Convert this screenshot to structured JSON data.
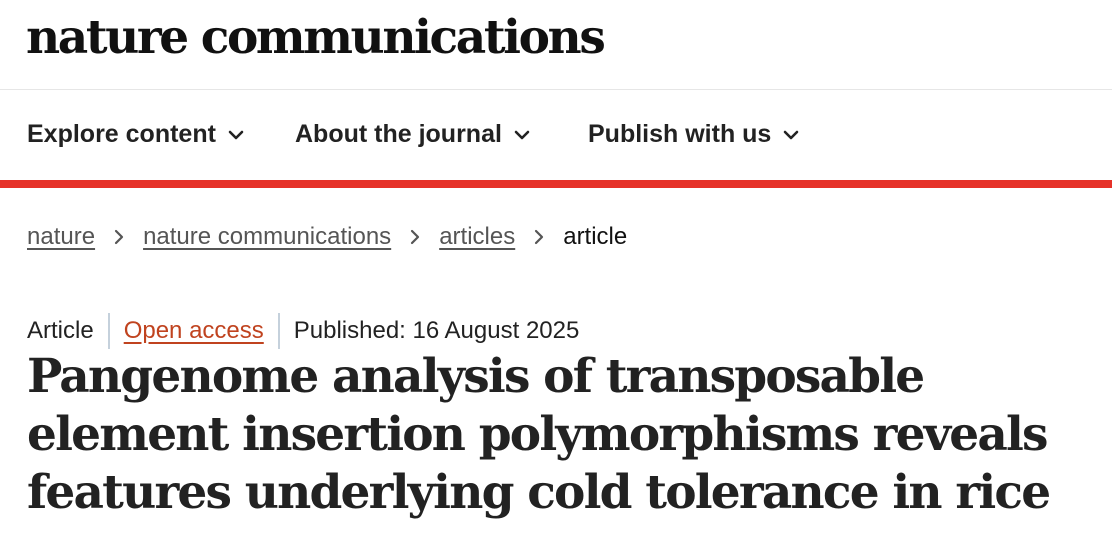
{
  "header": {
    "logo_text": "nature communications"
  },
  "nav": {
    "items": [
      {
        "label": "Explore content",
        "icon": "chevron-down-icon"
      },
      {
        "label": "About the journal",
        "icon": "chevron-down-icon"
      },
      {
        "label": "Publish with us",
        "icon": "chevron-down-icon"
      }
    ],
    "accent_color": "#e63229"
  },
  "breadcrumb": {
    "items": [
      {
        "label": "nature"
      },
      {
        "label": "nature communications"
      },
      {
        "label": "articles"
      }
    ],
    "current": "article",
    "separator_icon": "chevron-right-icon"
  },
  "article": {
    "type": "Article",
    "access": "Open access",
    "access_color": "#c0431f",
    "published": "Published: 16 August 2025",
    "title": "Pangenome analysis of transposable element insertion polymorphisms reveals features underlying cold tolerance in rice"
  }
}
